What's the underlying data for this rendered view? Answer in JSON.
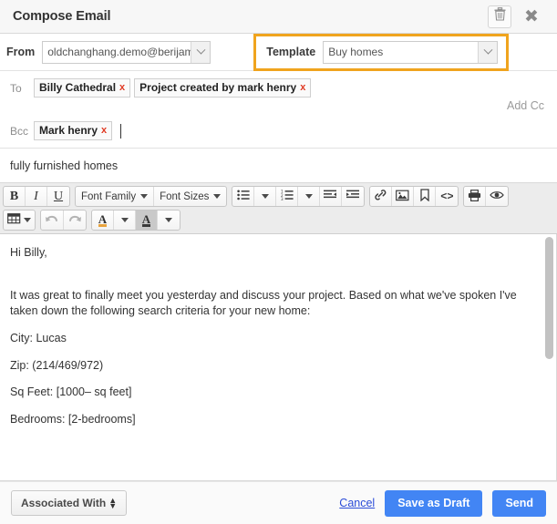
{
  "window": {
    "title": "Compose Email",
    "trash_icon": "trash-icon",
    "close_icon": "close-icon"
  },
  "from": {
    "label": "From",
    "value": "oldchanghang.demo@berijam.c",
    "full_value": "oldchanghang.demo@berijam.c"
  },
  "template": {
    "label": "Template",
    "value": "Buy homes",
    "highlight_color": "#f0a41e"
  },
  "recipients": {
    "to_label": "To",
    "to_chips": [
      {
        "name": "Billy Cathedral",
        "remove": "x"
      },
      {
        "name": "Project created by mark henry",
        "remove": "x"
      }
    ],
    "add_cc_label": "Add Cc",
    "bcc_label": "Bcc",
    "bcc_chips": [
      {
        "name": "Mark henry",
        "remove": "x"
      }
    ]
  },
  "subject": {
    "value": "fully furnished homes"
  },
  "toolbar": {
    "bold": "B",
    "italic": "I",
    "underline": "U",
    "font_family": "Font Family",
    "font_sizes": "Font Sizes",
    "bullet_list": "bullet-list-icon",
    "numbered_list": "numbered-list-icon",
    "outdent": "outdent-icon",
    "indent": "indent-icon",
    "link": "link-icon",
    "image": "image-icon",
    "bookmark": "bookmark-icon",
    "source_code": "<>",
    "print": "print-icon",
    "preview": "preview-eye-icon",
    "table": "table-icon",
    "undo": "undo-icon",
    "redo": "redo-icon",
    "text_color": "A",
    "background_color": "A"
  },
  "body": {
    "greeting": "Hi Billy,",
    "paragraph": "It was great to finally meet you yesterday and discuss your project.  Based on what we've spoken I've taken down the following search criteria for your new home:",
    "city": "City: Lucas",
    "zip": "Zip: (214/469/972)",
    "sq_feet": "Sq Feet: [1000– sq feet]",
    "bedrooms": "Bedrooms: [2-bedrooms]"
  },
  "footer": {
    "associated_with": "Associated With",
    "cancel": "Cancel",
    "save_draft": "Save as Draft",
    "send": "Send",
    "primary_color": "#4285f4"
  }
}
